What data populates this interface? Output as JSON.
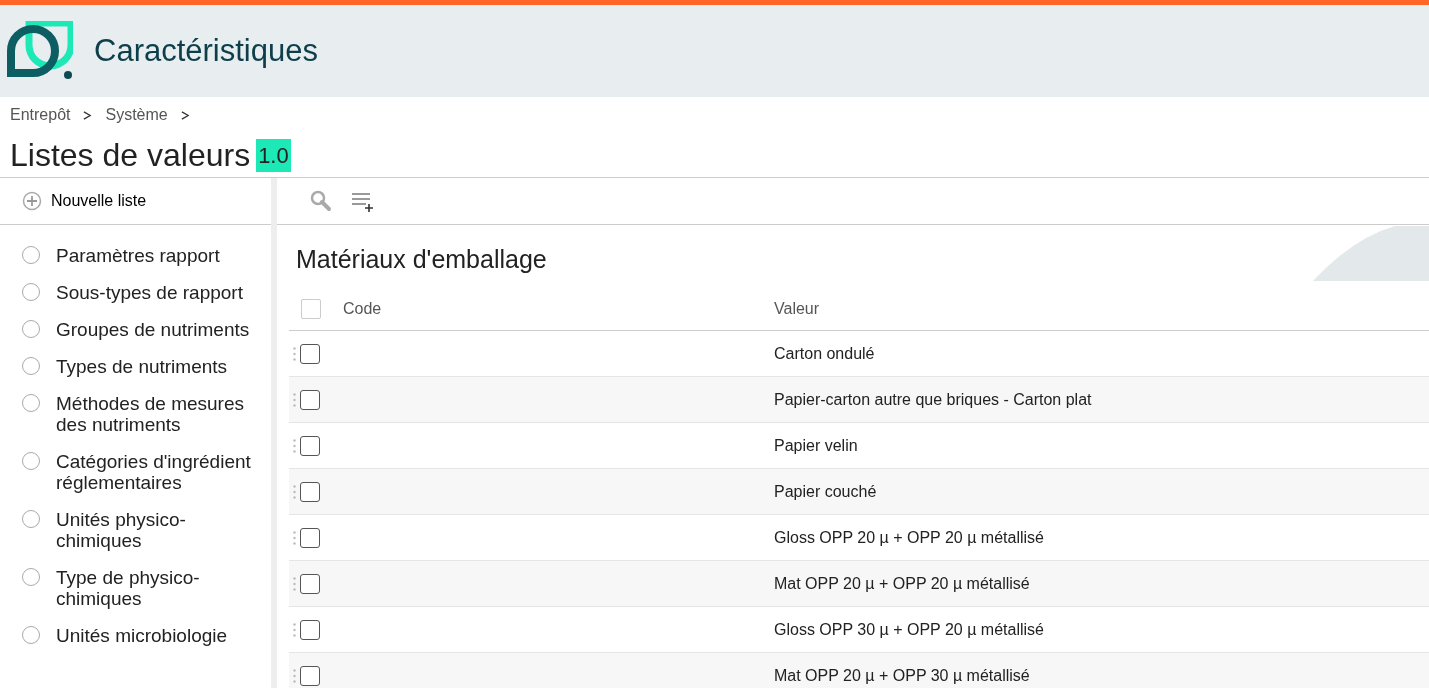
{
  "header": {
    "title": "Caractéristiques"
  },
  "breadcrumb": [
    "Entrepôt",
    "Système"
  ],
  "page": {
    "title": "Listes de valeurs",
    "version": "1.0"
  },
  "sidebar": {
    "new_button": "Nouvelle liste",
    "items": [
      {
        "label": "Paramètres rapport",
        "selected": false
      },
      {
        "label": "Sous-types de rapport",
        "selected": false
      },
      {
        "label": "Groupes de nutriments",
        "selected": false
      },
      {
        "label": "Types de nutriments",
        "selected": false
      },
      {
        "label": "Méthodes de mesures des nutriments",
        "selected": false
      },
      {
        "label": "Catégories d'ingrédient réglementaires",
        "selected": false
      },
      {
        "label": "Unités physico-chimiques",
        "selected": false
      },
      {
        "label": "Type de physico-chimiques",
        "selected": false
      },
      {
        "label": "Unités microbiologie",
        "selected": false
      }
    ]
  },
  "list": {
    "title": "Matériaux d'emballage",
    "columns": [
      "Code",
      "Valeur"
    ],
    "all_checked": false,
    "rows": [
      {
        "code": "",
        "value": "Carton ondulé",
        "checked": false
      },
      {
        "code": "",
        "value": "Papier-carton autre que briques - Carton plat",
        "checked": false
      },
      {
        "code": "",
        "value": "Papier velin",
        "checked": false
      },
      {
        "code": "",
        "value": "Papier couché",
        "checked": false
      },
      {
        "code": "",
        "value": "Gloss OPP 20 µ + OPP 20 µ métallisé",
        "checked": false
      },
      {
        "code": "",
        "value": "Mat OPP 20 µ + OPP 20 µ métallisé",
        "checked": false
      },
      {
        "code": "",
        "value": "Gloss OPP 30 µ + OPP 20 µ métallisé",
        "checked": false
      },
      {
        "code": "",
        "value": "Mat OPP 20 µ + OPP 30 µ métallisé",
        "checked": false
      }
    ]
  }
}
